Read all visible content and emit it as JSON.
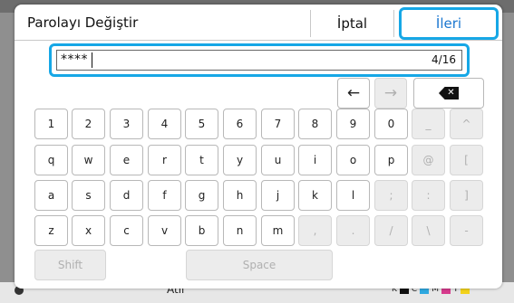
{
  "dialog": {
    "title": "Parolayı Değiştir",
    "cancel_label": "İptal",
    "next_label": "İleri"
  },
  "password_field": {
    "value": "****",
    "counter": "4/16"
  },
  "nav_keys": {
    "left_arrow": "←",
    "right_arrow": "→",
    "backspace": "✕"
  },
  "keyboard": {
    "row1": [
      "1",
      "2",
      "3",
      "4",
      "5",
      "6",
      "7",
      "8",
      "9",
      "0",
      "_",
      "^"
    ],
    "row2": [
      "q",
      "w",
      "e",
      "r",
      "t",
      "y",
      "u",
      "i",
      "o",
      "p",
      "@",
      "["
    ],
    "row3": [
      "a",
      "s",
      "d",
      "f",
      "g",
      "h",
      "j",
      "k",
      "l",
      ";",
      ":",
      "]"
    ],
    "row4": [
      "z",
      "x",
      "c",
      "v",
      "b",
      "n",
      "m",
      ",",
      ".",
      "/",
      "\\",
      "-"
    ],
    "shift_label": "Shift",
    "space_label": "Space"
  },
  "background": {
    "bottom_label": "Atıl",
    "toner_labels": [
      "K",
      "C",
      "M",
      "Y"
    ],
    "toner_colors": [
      "#111111",
      "#2fa8e0",
      "#d63a8c",
      "#f2d21b"
    ]
  },
  "colors": {
    "accent": "#16a7e6",
    "next_text": "#1b77d0"
  }
}
